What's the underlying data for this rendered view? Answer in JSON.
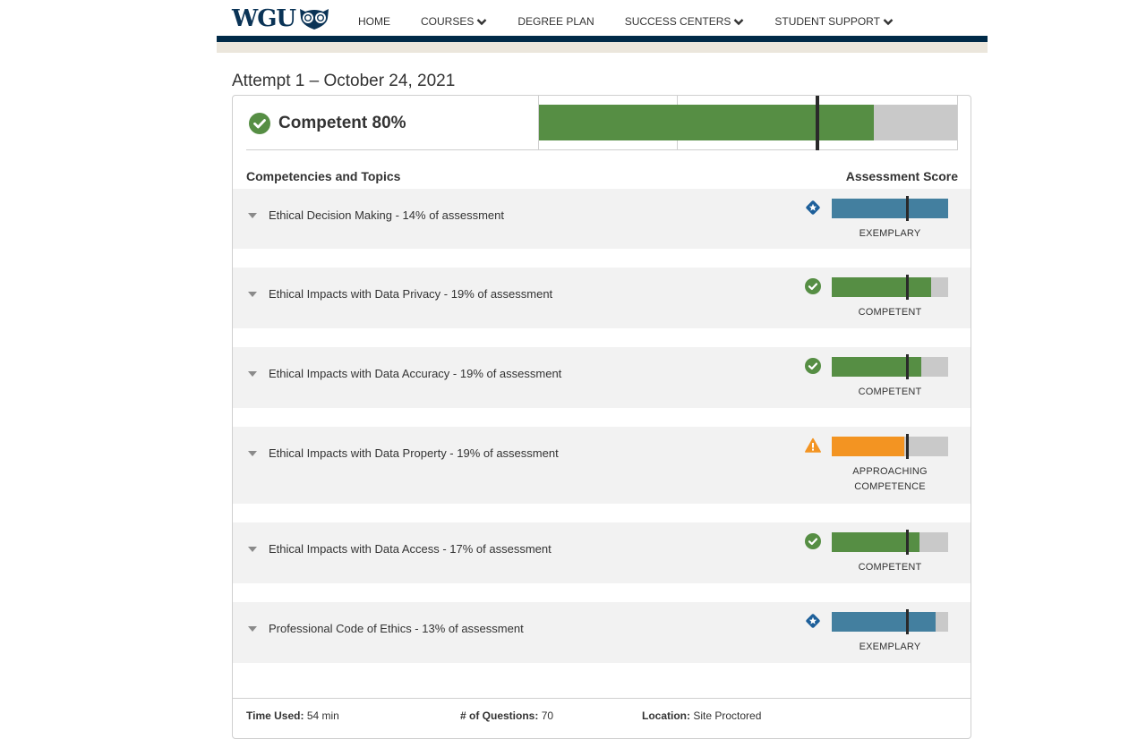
{
  "nav": {
    "logo_text": "WGU",
    "logo_icon": "owl-icon",
    "items": [
      {
        "label": "HOME",
        "has_dropdown": false
      },
      {
        "label": "COURSES",
        "has_dropdown": true
      },
      {
        "label": "DEGREE PLAN",
        "has_dropdown": false
      },
      {
        "label": "SUCCESS CENTERS",
        "has_dropdown": true
      },
      {
        "label": "STUDENT SUPPORT",
        "has_dropdown": true
      }
    ]
  },
  "attempt": {
    "title": "Attempt 1 – October 24, 2021",
    "summary": {
      "label": "Competent 80%",
      "icon": "check-circle-icon",
      "score_percent": 80,
      "cut_score_percent": 66.5,
      "color": "#568e44"
    },
    "headers": {
      "left": "Competencies and Topics",
      "right": "Assessment Score"
    },
    "competencies": [
      {
        "label": "Ethical Decision Making - 14% of assessment",
        "status": "EXEMPLARY",
        "icon": "star-diamond-icon",
        "score_percent": 100,
        "cut_percent": 65,
        "color": "#437f9f"
      },
      {
        "label": "Ethical Impacts with Data Privacy - 19% of assessment",
        "status": "COMPETENT",
        "icon": "check-circle-icon",
        "score_percent": 85,
        "cut_percent": 65,
        "color": "#568e44"
      },
      {
        "label": "Ethical Impacts with Data Accuracy - 19% of assessment",
        "status": "COMPETENT",
        "icon": "check-circle-icon",
        "score_percent": 77,
        "cut_percent": 65,
        "color": "#568e44"
      },
      {
        "label": "Ethical Impacts with Data Property - 19% of assessment",
        "status": "APPROACHING COMPETENCE",
        "status_lines": [
          "APPROACHING",
          "COMPETENCE"
        ],
        "icon": "warning-triangle-icon",
        "score_percent": 62,
        "cut_percent": 65,
        "color": "#f39422"
      },
      {
        "label": "Ethical Impacts with Data Access - 17% of assessment",
        "status": "COMPETENT",
        "icon": "check-circle-icon",
        "score_percent": 75,
        "cut_percent": 65,
        "color": "#568e44"
      },
      {
        "label": "Professional Code of Ethics - 13% of assessment",
        "status": "EXEMPLARY",
        "icon": "star-diamond-icon",
        "score_percent": 89,
        "cut_percent": 65,
        "color": "#437f9f"
      }
    ],
    "footer": {
      "time_used_label": "Time Used:",
      "time_used_value": "54 min",
      "questions_label": "# of Questions:",
      "questions_value": "70",
      "location_label": "Location:",
      "location_value": "Site Proctored"
    }
  }
}
